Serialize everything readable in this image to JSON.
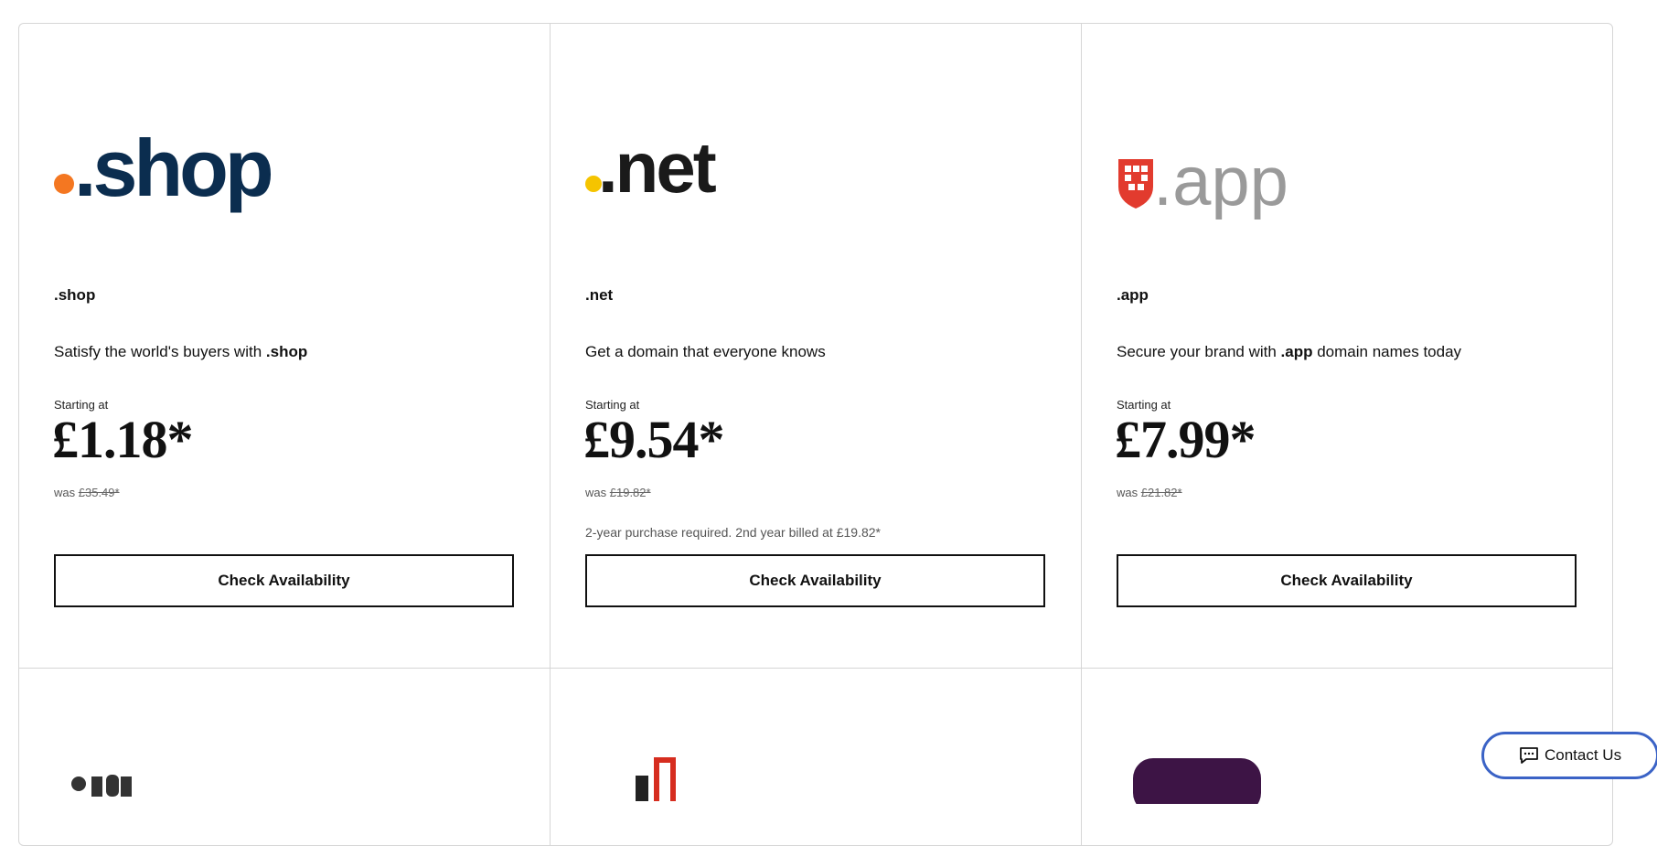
{
  "cards": [
    {
      "logo_text": ".shop",
      "tld": ".shop",
      "desc_pre": "Satisfy the world's buyers with ",
      "desc_bold": ".shop",
      "desc_post": "",
      "starting_label": "Starting at",
      "price": "£1.18*",
      "was_label": "was",
      "was_price": "£35.49*",
      "note": "",
      "button": "Check Availability"
    },
    {
      "logo_text": ".net",
      "tld": ".net",
      "desc_pre": "Get a domain that everyone knows",
      "desc_bold": "",
      "desc_post": "",
      "starting_label": "Starting at",
      "price": "£9.54*",
      "was_label": "was",
      "was_price": "£19.82*",
      "note": "2-year purchase required. 2nd year billed at £19.82*",
      "button": "Check Availability"
    },
    {
      "logo_text": ".app",
      "tld": ".app",
      "desc_pre": "Secure your brand with ",
      "desc_bold": ".app",
      "desc_post": " domain names today",
      "starting_label": "Starting at",
      "price": "£7.99*",
      "was_label": "was",
      "was_price": "£21.82*",
      "note": "",
      "button": "Check Availability"
    }
  ],
  "contact_button": "Contact Us",
  "colors": {
    "shop_navy": "#0b2d4f",
    "shop_dot": "#f47721",
    "net_dot": "#f5c400",
    "app_red": "#e23b2e",
    "app_gray": "#9a9a9a",
    "contact_border": "#3b63c6"
  }
}
